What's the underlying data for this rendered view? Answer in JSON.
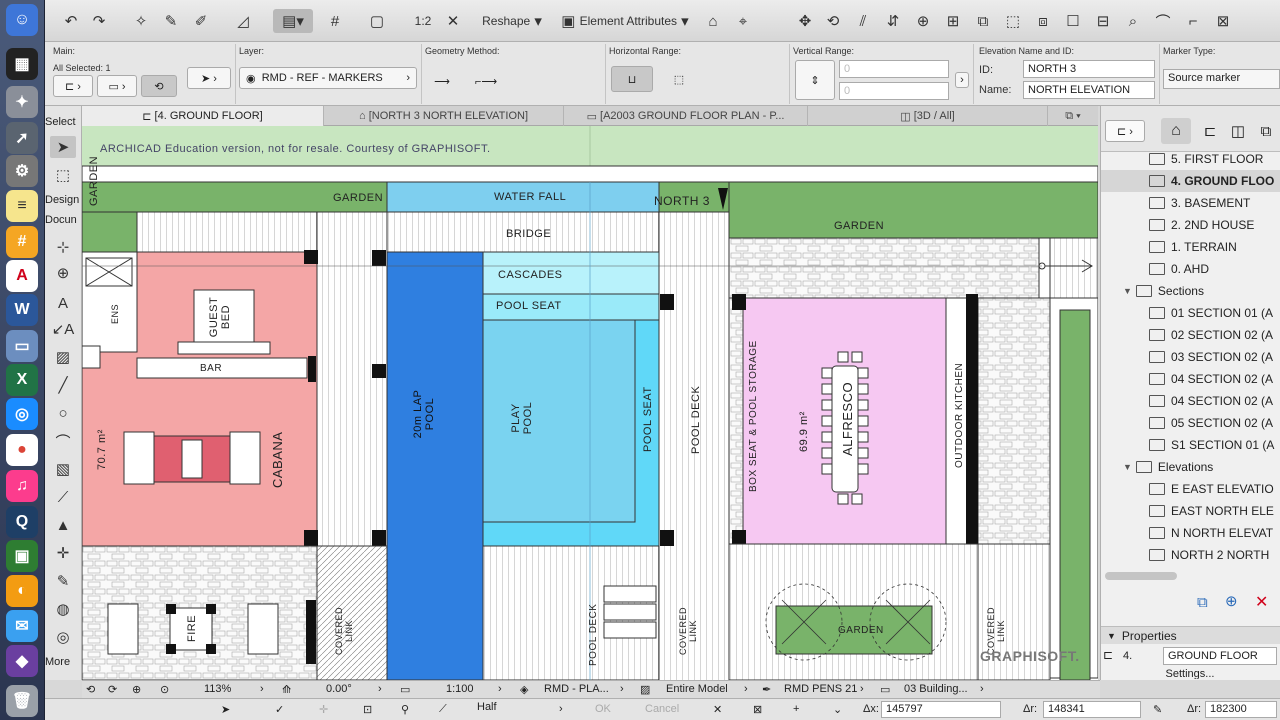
{
  "toolbar": {
    "reshape_label": "Reshape",
    "element_attributes_label": "Element Attributes",
    "scale_label": "1:2"
  },
  "infobox": {
    "main_label": "Main:",
    "all_selected": "All Selected: 1",
    "layer_label": "Layer:",
    "layer_value": "RMD - REF - MARKERS",
    "geometry_label": "Geometry Method:",
    "hrange_label": "Horizontal Range:",
    "vrange_label": "Vertical Range:",
    "vrange_top": "0",
    "vrange_bottom": "0",
    "elev_label": "Elevation Name and ID:",
    "id_label": "ID:",
    "id_value": "NORTH 3",
    "name_label": "Name:",
    "name_value": "NORTH ELEVATION",
    "marker_label": "Marker Type:",
    "marker_value": "Source marker"
  },
  "tabs": [
    {
      "label": "[4. GROUND FLOOR]"
    },
    {
      "label": "[NORTH 3 NORTH ELEVATION]"
    },
    {
      "label": "[A2003 GROUND FLOOR PLAN - P..."
    },
    {
      "label": "[3D / All]"
    }
  ],
  "toolbox": {
    "select": "Select",
    "design": "Design",
    "document": "Docun",
    "more": "More"
  },
  "canvas": {
    "watermark": "ARCHICAD Education version, not for resale. Courtesy of GRAPHISOFT.",
    "brand": "GRAPHISOFT.",
    "labels": {
      "garden_top": "GARDEN",
      "garden_left": "GARDEN",
      "water_fall": "WATER FALL",
      "north_marker": "NORTH 3",
      "garden_right": "GARDEN",
      "bridge": "BRIDGE",
      "cascades": "CASCADES",
      "pool_seat_top": "POOL SEAT",
      "ens": "ENS",
      "guest_bed": "GUEST BED",
      "bar": "BAR",
      "lap_pool": "20m LAP POOL",
      "play_pool": "PLAY POOL",
      "pool_seat_side": "POOL SEAT",
      "pool_deck_1": "POOL DECK",
      "box_seat": "BOX SEAT & POOL STORAGE",
      "alfresco_area": "69.9 m²",
      "alfresco": "ALFRESCO",
      "outdoor_kitchen": "OUTDOOR KITCHEN",
      "cabana_area": "70.7 m²",
      "cabana": "CABANA",
      "fire": "FIRE",
      "covered_link_1": "COVERED LINK",
      "pool_deck_2": "POOL DECK",
      "covered_link_2": "COVERED LINK",
      "garden_bottom": "GARDEN",
      "covered_link_3": "COVERED LINK"
    }
  },
  "navigator": {
    "rows": [
      {
        "label": "5. FIRST FLOOR",
        "indent": 1,
        "kind": "story"
      },
      {
        "label": "4. GROUND FLOO",
        "indent": 1,
        "kind": "story",
        "selected": true
      },
      {
        "label": "3. BASEMENT",
        "indent": 1,
        "kind": "story"
      },
      {
        "label": "2. 2ND HOUSE",
        "indent": 1,
        "kind": "story"
      },
      {
        "label": "1. TERRAIN",
        "indent": 1,
        "kind": "story"
      },
      {
        "label": "0. AHD",
        "indent": 1,
        "kind": "story"
      },
      {
        "label": "Sections",
        "indent": 0,
        "kind": "group"
      },
      {
        "label": "01 SECTION 01 (A",
        "indent": 1,
        "kind": "section"
      },
      {
        "label": "02 SECTION 02 (A",
        "indent": 1,
        "kind": "section"
      },
      {
        "label": "03 SECTION 02 (A",
        "indent": 1,
        "kind": "section"
      },
      {
        "label": "04 SECTION 02 (A",
        "indent": 1,
        "kind": "section"
      },
      {
        "label": "04 SECTION 02 (A",
        "indent": 1,
        "kind": "section"
      },
      {
        "label": "05 SECTION 02 (A",
        "indent": 1,
        "kind": "section"
      },
      {
        "label": "S1 SECTION 01 (A",
        "indent": 1,
        "kind": "section"
      },
      {
        "label": "Elevations",
        "indent": 0,
        "kind": "group"
      },
      {
        "label": "E EAST ELEVATIO",
        "indent": 1,
        "kind": "elevation"
      },
      {
        "label": "EAST NORTH ELE",
        "indent": 1,
        "kind": "elevation"
      },
      {
        "label": "N NORTH ELEVAT",
        "indent": 1,
        "kind": "elevation"
      },
      {
        "label": "NORTH 2 NORTH",
        "indent": 1,
        "kind": "elevation"
      }
    ],
    "properties_label": "Properties",
    "prop_id": "4.",
    "prop_value": "GROUND FLOOR",
    "settings_label": "Settings..."
  },
  "statusbar": {
    "zoom": "113%",
    "angle": "0.00°",
    "scale": "1:100",
    "layer_combo": "RMD - PLA...",
    "model_view": "Entire Model",
    "pen_set": "RMD PENS 21",
    "renovation": "03 Building..."
  },
  "trackbar": {
    "half_label": "Half",
    "ok_label": "OK",
    "cancel_label": "Cancel",
    "dx_label": "Δx:",
    "dx_value": "145797",
    "dy_label": "Δr:",
    "dy_value": "148341",
    "dz_label": "Δr:",
    "dz_value": "182300"
  }
}
